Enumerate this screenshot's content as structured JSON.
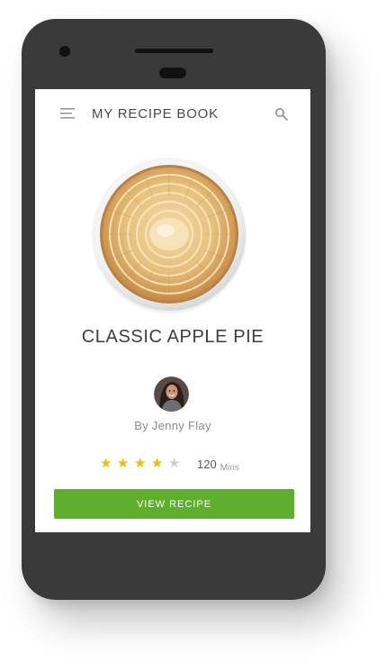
{
  "app": {
    "title": "MY RECIPE BOOK",
    "menu_icon": "hamburger-menu-icon",
    "search_icon": "search-icon"
  },
  "recipe": {
    "image": "apple-pie-photo",
    "title": "CLASSIC APPLE PIE",
    "author": "By Jenny Flay",
    "rating": 4,
    "rating_max": 5,
    "duration_value": "120",
    "duration_unit": "Mins",
    "cta_label": "VIEW RECIPE"
  },
  "colors": {
    "accent_green": "#5fae2e",
    "star_yellow": "#f5b800",
    "star_gray": "#cfcfcf",
    "phone_body": "#3a3a3a"
  }
}
